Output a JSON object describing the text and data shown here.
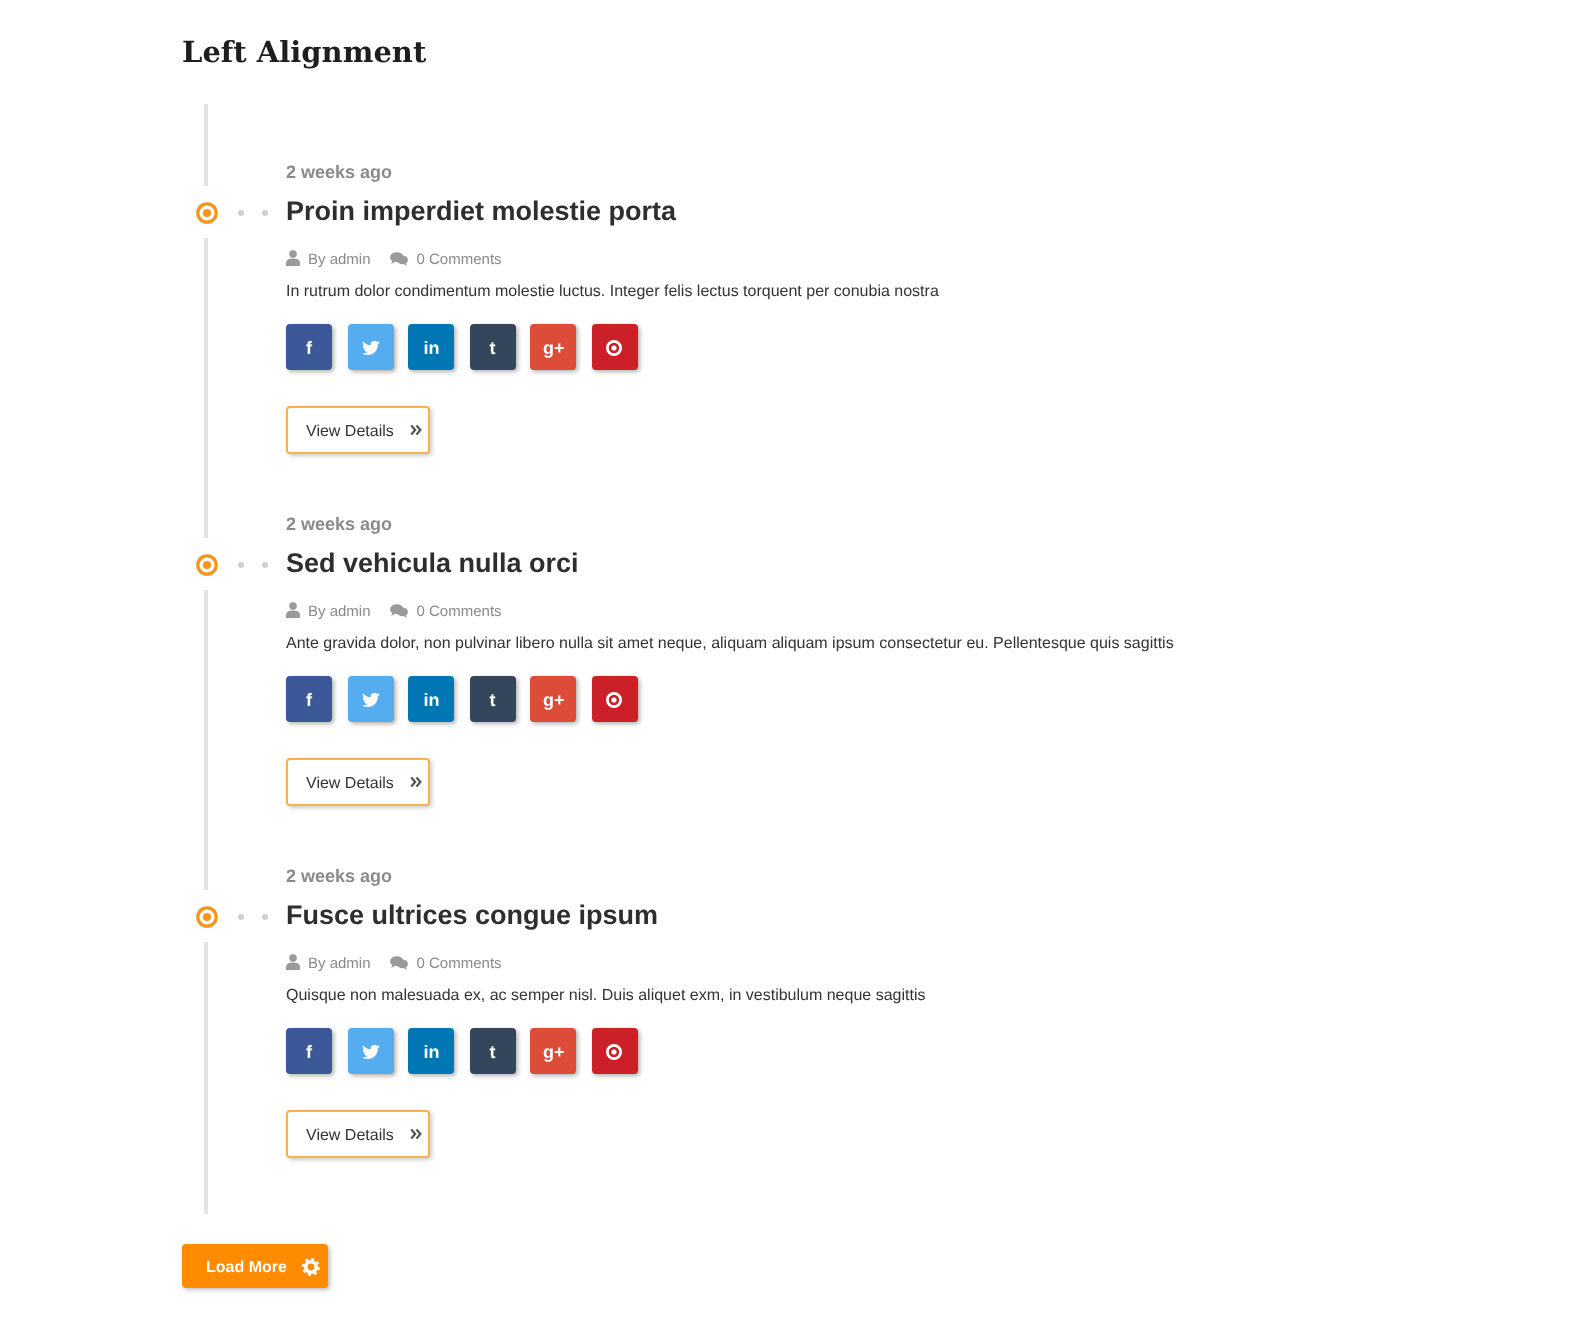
{
  "heading": "Left Alignment",
  "posts": [
    {
      "date": "2 weeks ago",
      "title": "Proin imperdiet molestie porta",
      "author": "By admin",
      "comments": "0 Comments",
      "excerpt": "In rutrum dolor condimentum molestie luctus. Integer felis lectus torquent per conubia nostra",
      "share_buttons": [
        {
          "kind": "letter",
          "glyph": "f",
          "color": "#3b5998"
        },
        {
          "kind": "bird",
          "color": "#55acee"
        },
        {
          "kind": "letter",
          "glyph": "in",
          "color": "#0077b5"
        },
        {
          "kind": "letter",
          "glyph": "t",
          "color": "#35465c"
        },
        {
          "kind": "letter",
          "glyph": "g+",
          "color": "#dd4b39"
        },
        {
          "kind": "pin",
          "color": "#cb2027"
        }
      ],
      "button": "View Details"
    },
    {
      "date": "2 weeks ago",
      "title": "Sed vehicula nulla orci",
      "author": "By admin",
      "comments": "0 Comments",
      "excerpt": "Ante gravida dolor, non pulvinar libero nulla sit amet neque, aliquam aliquam ipsum consectetur eu. Pellentesque quis sagittis",
      "share_buttons": [
        {
          "kind": "letter",
          "glyph": "f",
          "color": "#3b5998"
        },
        {
          "kind": "bird",
          "color": "#55acee"
        },
        {
          "kind": "letter",
          "glyph": "in",
          "color": "#0077b5"
        },
        {
          "kind": "letter",
          "glyph": "t",
          "color": "#35465c"
        },
        {
          "kind": "letter",
          "glyph": "g+",
          "color": "#dd4b39"
        },
        {
          "kind": "pin",
          "color": "#cb2027"
        }
      ],
      "button": "View Details"
    },
    {
      "date": "2 weeks ago",
      "title": "Fusce ultrices congue ipsum",
      "author": "By admin",
      "comments": "0 Comments",
      "excerpt": "Quisque non malesuada ex, ac semper nisl. Duis aliquet exm, in vestibulum neque sagittis",
      "share_buttons": [
        {
          "kind": "letter",
          "glyph": "f",
          "color": "#3b5998"
        },
        {
          "kind": "bird",
          "color": "#55acee"
        },
        {
          "kind": "letter",
          "glyph": "in",
          "color": "#0077b5"
        },
        {
          "kind": "letter",
          "glyph": "t",
          "color": "#35465c"
        },
        {
          "kind": "letter",
          "glyph": "g+",
          "color": "#dd4b39"
        },
        {
          "kind": "pin",
          "color": "#cb2027"
        }
      ],
      "button": "View Details"
    }
  ],
  "load_more": "Load More"
}
